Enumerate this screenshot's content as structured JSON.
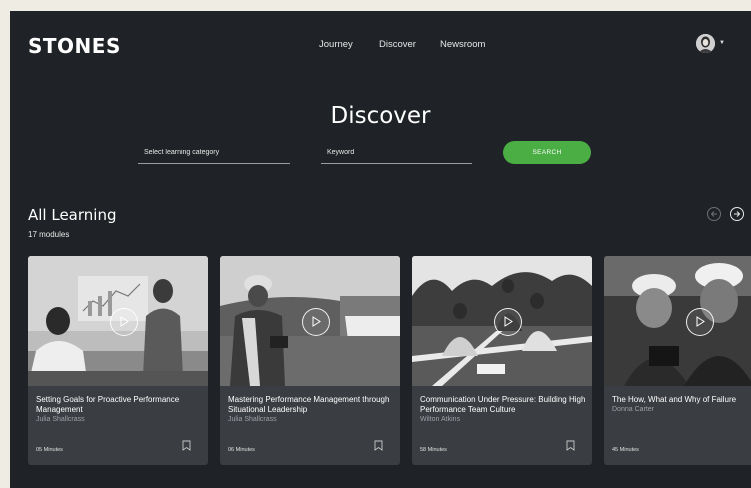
{
  "brand": {
    "logo": "STONES"
  },
  "nav": {
    "items": [
      "Journey",
      "Discover",
      "Newsroom"
    ]
  },
  "page": {
    "title": "Discover"
  },
  "search": {
    "category_placeholder": "Select learning category",
    "keyword_placeholder": "Keyword",
    "button_label": "SEARCH",
    "accent_color": "#4aae45"
  },
  "section": {
    "title": "All Learning",
    "count": "17 modules"
  },
  "cards": [
    {
      "title": "Setting Goals for Proactive Performance Management",
      "author": "Julia Shallcrass",
      "duration": "05 Minutes",
      "icon": "bookmark-icon"
    },
    {
      "title": "Mastering Performance Management through Situational Leadership",
      "author": "Julia Shallcrass",
      "duration": "06 Minutes",
      "icon": "bookmark-icon"
    },
    {
      "title": "Communication Under Pressure: Building High Performance Team Culture",
      "author": "Wilton Atkins",
      "duration": "58 Minutes",
      "icon": "bookmark-icon"
    },
    {
      "title": "The How, What and Why of Failure",
      "author": "Donna Carter",
      "duration": "45 Minutes",
      "icon": "bookmark-icon"
    }
  ]
}
